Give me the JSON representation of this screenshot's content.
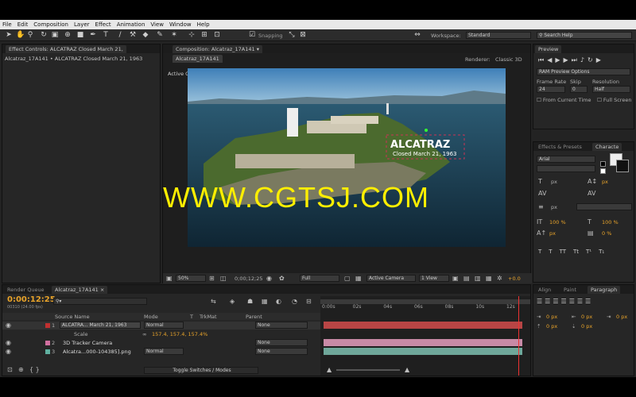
{
  "menu": [
    "File",
    "Edit",
    "Composition",
    "Layer",
    "Effect",
    "Animation",
    "View",
    "Window",
    "Help"
  ],
  "toolbar": {
    "snapping_label": "Snapping",
    "workspace_label": "Workspace:",
    "workspace_value": "Standard",
    "search_placeholder": "Search Help"
  },
  "effect_controls": {
    "tab_label": "Effect Controls: ALCATRAZ Closed March 21,",
    "breadcrumb": "Alcatraz_17A141 • ALCATRAZ Closed March 21, 1963"
  },
  "composition": {
    "tab_label": "Composition: Alcatraz_17A141",
    "subtab": "Alcatraz_17A141",
    "renderer_label": "Renderer:",
    "renderer_value": "Classic 3D",
    "active_camera": "Active Camera",
    "overlay_title": "ALCATRAZ",
    "overlay_sub": "Closed March 21, 1963",
    "zoom": "50%",
    "timecode": "0;00;12;25",
    "resolution": "Full",
    "view": "Active Camera",
    "views": "1 View",
    "exposure": "+0.0"
  },
  "watermark": "WWW.CGTSJ.COM",
  "preview": {
    "tab_label": "Preview",
    "ram_options": "RAM Preview Options",
    "frame_rate_label": "Frame Rate",
    "frame_rate_value": "24",
    "skip_label": "Skip",
    "skip_value": "0",
    "resolution_label": "Resolution",
    "resolution_value": "Half",
    "from_current": "From Current Time",
    "full_screen": "Full Screen"
  },
  "effects_presets": {
    "tab1": "Effects & Presets",
    "tab2": "Characte"
  },
  "character": {
    "font": "Arial",
    "px1": "px",
    "px2": "px",
    "px3": "px",
    "px4": "px",
    "px5": "px",
    "scale_v": "100 %",
    "scale_h": "100 %",
    "baseline": "px",
    "tsume": "0 %",
    "styles": [
      "T",
      "T",
      "TT",
      "Tt",
      "T¹",
      "T₁"
    ]
  },
  "align": {
    "tab1": "Align",
    "tab2": "Paint",
    "tab3": "Paragraph",
    "vals": [
      "0 px",
      "0 px",
      "0 px",
      "0 px",
      "0 px"
    ]
  },
  "timeline": {
    "tab1": "Render Queue",
    "tab2": "Alcatraz_17A141",
    "timecode": "0:00:12:25",
    "fps_info": "00310 (24.00 fps)",
    "search_placeholder": "",
    "col_source": "Source Name",
    "col_mode": "Mode",
    "col_t": "T",
    "col_trkmat": "TrkMat",
    "col_parent": "Parent",
    "layers": [
      {
        "num": "1",
        "name": "ALCATRA... March 21, 1963",
        "mode": "Normal",
        "parent": "None",
        "color": "#c03030"
      },
      {
        "num": "2",
        "name": "3D Tracker Camera",
        "mode": "",
        "parent": "None",
        "color": "#d070a0"
      },
      {
        "num": "3",
        "name": "Alcatra...000-104385].png",
        "mode": "Normal",
        "parent": "None",
        "color": "#60b0a0"
      }
    ],
    "scale_label": "Scale",
    "scale_value": "157.4, 157.4, 157.4%",
    "ruler": [
      "0:00s",
      "02s",
      "04s",
      "06s",
      "08s",
      "10s",
      "12s"
    ],
    "toggle_label": "Toggle Switches / Modes"
  }
}
